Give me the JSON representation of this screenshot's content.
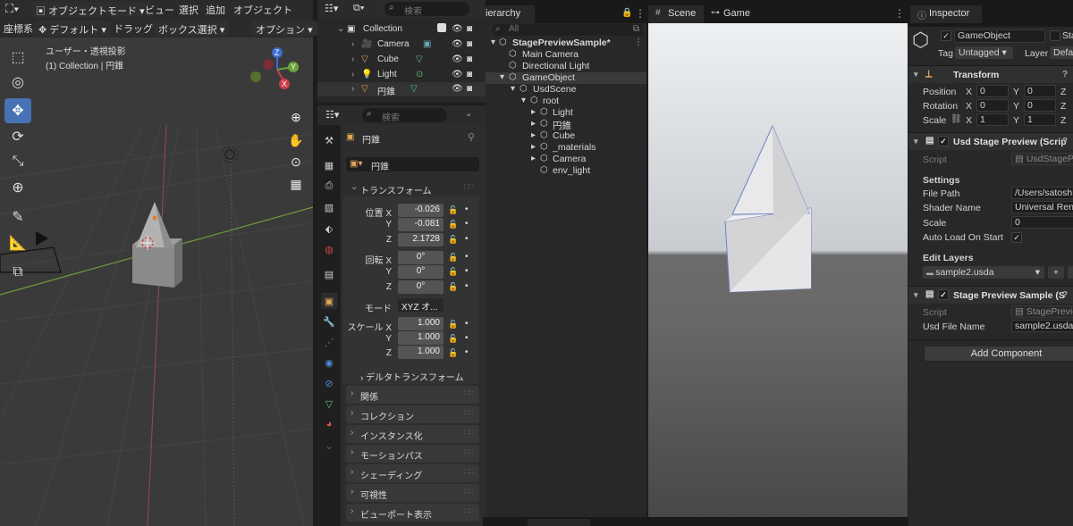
{
  "blender": {
    "header": {
      "mode": "オブジェクトモード",
      "menus": [
        "ビュー",
        "選択",
        "追加",
        "オブジェクト"
      ],
      "coord_label": "座標系:",
      "coord_value": "デフォルト",
      "drag_label": "ドラッグ:",
      "drag_value": "ボックス選択",
      "options": "オプション"
    },
    "viewport": {
      "view_name": "ユーザー・透視投影",
      "collection_info": "(1) Collection | 円錐",
      "gizmo": {
        "z": "Z",
        "y": "Y",
        "x": "X"
      }
    },
    "outliner": {
      "search_placeholder": "検索",
      "items": [
        {
          "name": "Collection"
        },
        {
          "name": "Camera"
        },
        {
          "name": "Cube"
        },
        {
          "name": "Light"
        },
        {
          "name": "円錐"
        }
      ]
    },
    "properties": {
      "search_placeholder": "検索",
      "object_title": "円錐",
      "object_name": "円錐",
      "transform_title": "トランスフォーム",
      "location_label": "位置 X",
      "rotation_label": "回転 X",
      "scale_label": "スケール X",
      "y_label": "Y",
      "z_label": "Z",
      "location": [
        "-0.026",
        "-0.081",
        "2.1728"
      ],
      "rotation": [
        "0°",
        "0°",
        "0°"
      ],
      "mode_label": "モード",
      "mode_value": "XYZ オ...",
      "scale": [
        "1.000",
        "1.000",
        "1.000"
      ],
      "delta_transform": "デルタトランスフォーム",
      "sections": [
        "関係",
        "コレクション",
        "インスタンス化",
        "モーションパス",
        "シェーディング",
        "可視性",
        "ビューポート表示"
      ]
    }
  },
  "unity": {
    "hierarchy": {
      "tab": "Hierarchy",
      "tab_visible": "ierarchy",
      "search_placeholder": "All",
      "items": [
        {
          "name": "StagePreviewSample*"
        },
        {
          "name": "Main Camera"
        },
        {
          "name": "Directional Light"
        },
        {
          "name": "GameObject"
        },
        {
          "name": "UsdScene"
        },
        {
          "name": "root"
        },
        {
          "name": "Light"
        },
        {
          "name": "円錐"
        },
        {
          "name": "Cube"
        },
        {
          "name": "_materials"
        },
        {
          "name": "Camera"
        },
        {
          "name": "env_light"
        }
      ]
    },
    "scene_tabs": {
      "scene": "Scene",
      "game": "Game"
    },
    "inspector": {
      "tab": "Inspector",
      "object_name": "GameObject",
      "static_label": "Sta",
      "tag_label": "Tag",
      "tag_value": "Untagged",
      "layer_label": "Layer",
      "layer_value": "Defa",
      "transform": {
        "title": "Transform",
        "position_label": "Position",
        "rotation_label": "Rotation",
        "scale_label": "Scale",
        "axis_x": "X",
        "axis_y": "Y",
        "axis_z": "Z",
        "position": [
          "0",
          "0"
        ],
        "rotation": [
          "0",
          "0"
        ],
        "scale": [
          "1",
          "1"
        ]
      },
      "usd_stage_preview": {
        "title": "Usd Stage Preview (Scrip",
        "script_label": "Script",
        "script_value": "UsdStagePre",
        "settings_label": "Settings",
        "file_path_label": "File Path",
        "file_path_value": "/Users/satoshi",
        "shader_label": "Shader Name",
        "shader_value": "Universal Rend",
        "scale_label": "Scale",
        "scale_value": "0",
        "auto_load_label": "Auto Load On Start",
        "edit_layers_label": "Edit Layers",
        "layer_value": "sample2.usda",
        "add_symbol": "+"
      },
      "stage_preview_sample": {
        "title": "Stage Preview Sample (S",
        "script_label": "Script",
        "script_value": "StagePrevie",
        "usd_file_label": "Usd File Name",
        "usd_file_value": "sample2.usda"
      },
      "add_component": "Add Component"
    }
  },
  "colors": {
    "blender_active": "#4772b3",
    "unity_bg": "#282828",
    "selected_row": "#3a3a3a"
  }
}
